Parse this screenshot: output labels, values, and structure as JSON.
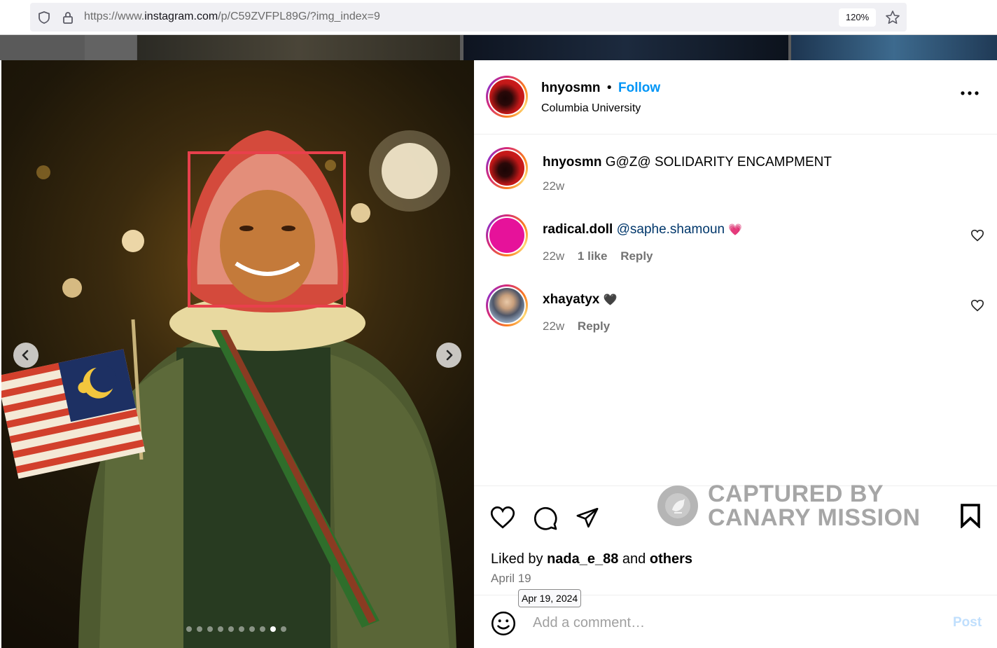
{
  "browser": {
    "url_prefix": "https://www.",
    "url_domain": "instagram.com",
    "url_path": "/p/C59ZVFPL89G/?img_index=9",
    "zoom": "120%",
    "icons": [
      "shield-icon",
      "lock-icon",
      "star-icon"
    ]
  },
  "post": {
    "author": "hnyosmn",
    "separator": "•",
    "follow_label": "Follow",
    "location": "Columbia University",
    "more_icon": "more-options-icon",
    "carousel": {
      "total_slides": 10,
      "active_index": 9
    }
  },
  "comments": [
    {
      "username": "hnyosmn",
      "text": "G@Z@ SOLIDARITY ENCAMPMENT",
      "time": "22w",
      "avatar": "red"
    },
    {
      "username": "radical.doll",
      "mention": "@saphe.shamoun",
      "emoji": "💗",
      "time": "22w",
      "likes": "1 like",
      "reply": "Reply",
      "avatar": "pink"
    },
    {
      "username": "xhayatyx",
      "emoji": "🖤",
      "time": "22w",
      "reply": "Reply",
      "avatar": "photo"
    }
  ],
  "actions": {
    "icons": [
      "heart-icon",
      "comment-icon",
      "share-icon",
      "bookmark-icon"
    ],
    "liked_by_prefix": "Liked by",
    "liked_by_user": "nada_e_88",
    "liked_by_and": "and",
    "liked_by_others": "others",
    "date": "April 19",
    "date_tooltip": "Apr 19, 2024"
  },
  "watermark": {
    "line1": "CAPTURED BY",
    "line2": "CANARY MISSION"
  },
  "composer": {
    "placeholder": "Add a comment…",
    "post_label": "Post"
  },
  "colors": {
    "link_blue": "#0095f6",
    "mention_blue": "#00376b",
    "muted": "#737373",
    "highlight_box": "#e8404c"
  }
}
